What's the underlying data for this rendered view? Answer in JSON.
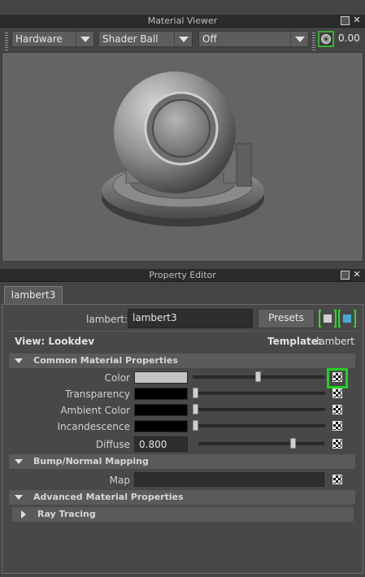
{
  "material_viewer": {
    "title": "Material Viewer",
    "renderer": "Hardware",
    "geometry": "Shader Ball",
    "lighting": "Off",
    "exposure": "0.00"
  },
  "property_editor": {
    "title": "Property Editor",
    "tab": "lambert3",
    "node_type_label": "lambert:",
    "node_name": "lambert3",
    "presets_label": "Presets",
    "view_label": "View: Lookdev",
    "template_label": "Template:",
    "template_value": "lambert",
    "sections": {
      "common": "Common Material Properties",
      "bump": "Bump/Normal Mapping",
      "advanced": "Advanced Material Properties",
      "raytracing": "Ray Tracing"
    },
    "attributes": {
      "color": "Color",
      "transparency": "Transparency",
      "ambient": "Ambient Color",
      "incandescence": "Incandescence",
      "diffuse": "Diffuse",
      "diffuse_value": "0.800",
      "map": "Map"
    },
    "slider_levels": {
      "color": 0.55,
      "transparency": 0.0,
      "ambient": 0.0,
      "incandescence": 0.0,
      "diffuse": 0.8
    },
    "colors": {
      "color_swatch": "#c4c4c4",
      "transparency_swatch": "#000000",
      "ambient_swatch": "#000000",
      "incandescence_swatch": "#000000",
      "highlight": "#22d022"
    }
  }
}
